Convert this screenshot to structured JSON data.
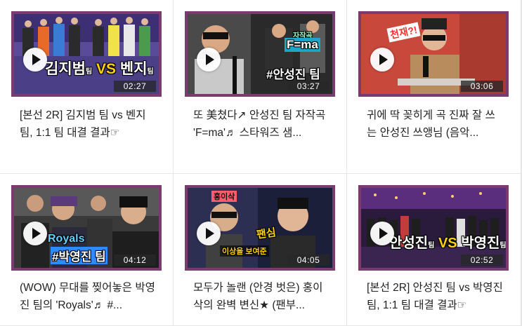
{
  "videos": [
    {
      "title": "[본선 2R] 김지범 팀 vs 벤지 팀, 1:1 팀 대결 결과☞",
      "duration": "02:27",
      "overlay": [
        "김지범",
        "VS",
        "벤지",
        "팀"
      ],
      "accent": "#ffd200"
    },
    {
      "title": "또 美쳤다↗ 안성진 팀 자작곡 'F=ma'♬ 스타워즈 샘...",
      "duration": "03:27",
      "overlay": [
        "자작곡",
        "F=ma",
        "#안성진 팀"
      ],
      "accent": "#00d7ff"
    },
    {
      "title": "귀에 딱 꽂히게 곡 진짜 잘 쓰는 안성진 쓰앵님 (음악...",
      "duration": "03:06",
      "overlay": [
        "천재?!"
      ],
      "accent": "#e43d3d"
    },
    {
      "title": "(WOW) 무대를 찢어놓은 박영진 팀의 'Royals'♬ #...",
      "duration": "04:12",
      "overlay": [
        "Royals",
        "#박영진 팀"
      ],
      "accent": "#1aa7ff"
    },
    {
      "title": "모두가 놀랜 (안경 벗은) 홍이삭의 완벽 변신★ (팬부...",
      "duration": "04:05",
      "overlay": [
        "홍이삭",
        "팬심",
        "이상을 보여준"
      ],
      "accent": "#ff4a6e"
    },
    {
      "title": "[본선 2R] 안성진 팀 vs 박영진 팀, 1:1 팀 대결 결과☞",
      "duration": "02:52",
      "overlay": [
        "안성진",
        "VS",
        "박영진",
        "팀"
      ],
      "accent": "#ffd200"
    }
  ]
}
